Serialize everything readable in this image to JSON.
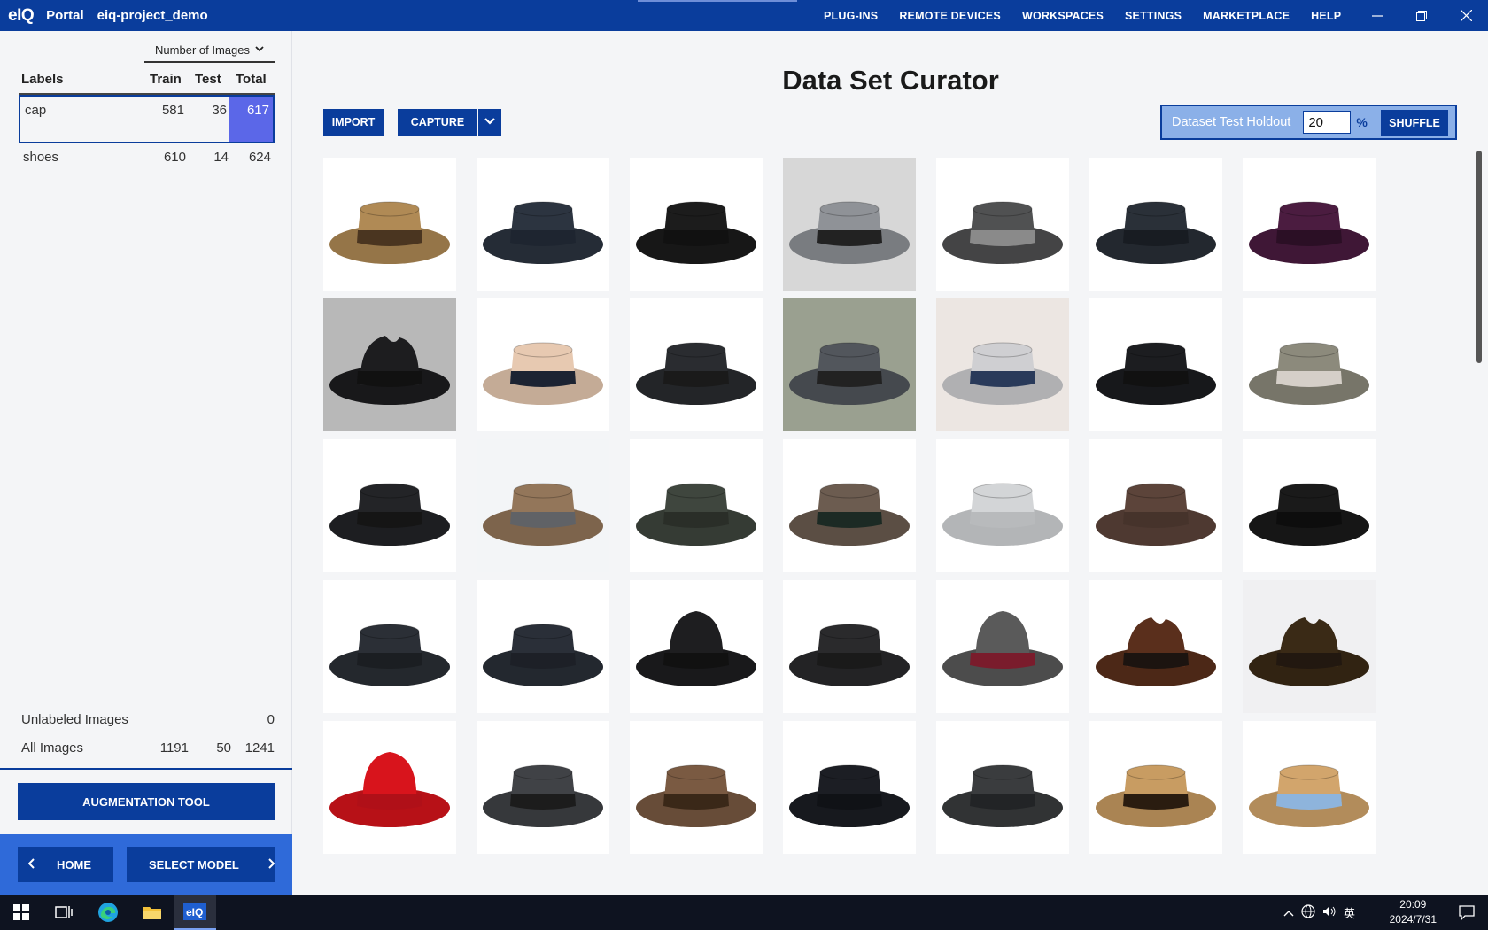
{
  "titlebar": {
    "logo": "eIQ",
    "app_name": "Portal",
    "project": "eiq-project_demo",
    "menu": [
      "PLUG-INS",
      "REMOTE DEVICES",
      "WORKSPACES",
      "SETTINGS",
      "MARKETPLACE",
      "HELP"
    ],
    "window_controls": [
      "minimize-icon",
      "restore-icon",
      "close-icon"
    ]
  },
  "sidebar": {
    "sort_select": "Number of Images",
    "headers": {
      "labels": "Labels",
      "train": "Train",
      "test": "Test",
      "total": "Total"
    },
    "labels": [
      {
        "name": "cap",
        "train": "581",
        "test": "36",
        "total": "617",
        "selected": true
      },
      {
        "name": "shoes",
        "train": "610",
        "test": "14",
        "total": "624",
        "selected": false
      }
    ],
    "unlabeled": {
      "name": "Unlabeled Images",
      "count": "0"
    },
    "all": {
      "name": "All Images",
      "train": "1191",
      "test": "50",
      "total": "1241"
    },
    "augmentation_button": "AUGMENTATION TOOL",
    "home_button": "HOME",
    "select_model_button": "SELECT MODEL"
  },
  "main": {
    "title": "Data Set Curator",
    "import_button": "IMPORT",
    "capture_button": "CAPTURE",
    "holdout": {
      "label": "Dataset Test Holdout",
      "value": "20",
      "unit": "%",
      "shuffle_button": "SHUFFLE"
    },
    "images": [
      {
        "hat": "#b08a55",
        "band": "#4a3520",
        "bg": "#ffffff",
        "style": "pork"
      },
      {
        "hat": "#2c3440",
        "band": "#1e2530",
        "bg": "#ffffff",
        "style": "pork"
      },
      {
        "hat": "#1c1c1c",
        "band": "#111111",
        "bg": "#ffffff",
        "style": "pork"
      },
      {
        "hat": "#8f9297",
        "band": "#222222",
        "bg": "#d7d7d7",
        "style": "pork"
      },
      {
        "hat": "#505152",
        "band": "#8a8a8a",
        "bg": "#ffffff",
        "style": "pork"
      },
      {
        "hat": "#2a3038",
        "band": "#181c22",
        "bg": "#ffffff",
        "style": "pork"
      },
      {
        "hat": "#4b1c40",
        "band": "#2b0f25",
        "bg": "#ffffff",
        "style": "pork"
      },
      {
        "hat": "#1d1d1f",
        "band": "#111111",
        "bg": "#b8b8b8",
        "style": "fedora"
      },
      {
        "hat": "#e7c9b1",
        "band": "#1c2332",
        "bg": "#ffffff",
        "style": "pork"
      },
      {
        "hat": "#2a2c30",
        "band": "#1a1a1a",
        "bg": "#ffffff",
        "style": "pork"
      },
      {
        "hat": "#52565c",
        "band": "#222222",
        "bg": "#9aa090",
        "style": "pork"
      },
      {
        "hat": "#cfcfd2",
        "band": "#293a5a",
        "bg": "#ece6e2",
        "style": "pork"
      },
      {
        "hat": "#1c1d20",
        "band": "#111111",
        "bg": "#ffffff",
        "style": "pork"
      },
      {
        "hat": "#8c8a7c",
        "band": "#d5cfc8",
        "bg": "#ffffff",
        "style": "pork"
      },
      {
        "hat": "#232427",
        "band": "#151515",
        "bg": "#ffffff",
        "style": "pork"
      },
      {
        "hat": "#93765a",
        "band": "#606266",
        "bg": "#f3f5f7",
        "style": "pork"
      },
      {
        "hat": "#3f463e",
        "band": "#2a2e28",
        "bg": "#ffffff",
        "style": "pork"
      },
      {
        "hat": "#6c5c50",
        "band": "#1c2a24",
        "bg": "#ffffff",
        "style": "pork"
      },
      {
        "hat": "#d3d5d7",
        "band": "#b8babc",
        "bg": "#ffffff",
        "style": "pork"
      },
      {
        "hat": "#5c443a",
        "band": "#46332b",
        "bg": "#ffffff",
        "style": "pork"
      },
      {
        "hat": "#1a1a1a",
        "band": "#0d0d0d",
        "bg": "#ffffff",
        "style": "pork"
      },
      {
        "hat": "#2b2f36",
        "band": "#1b1e22",
        "bg": "#ffffff",
        "style": "pork"
      },
      {
        "hat": "#2a2f38",
        "band": "#1d2027",
        "bg": "#ffffff",
        "style": "pork"
      },
      {
        "hat": "#1e1e20",
        "band": "#111111",
        "bg": "#ffffff",
        "style": "tall"
      },
      {
        "hat": "#2a2a2c",
        "band": "#1a1a1a",
        "bg": "#ffffff",
        "style": "pork"
      },
      {
        "hat": "#5a5a5a",
        "band": "#7a1c2c",
        "bg": "#ffffff",
        "style": "tall"
      },
      {
        "hat": "#5a2f1c",
        "band": "#1c1410",
        "bg": "#ffffff",
        "style": "fedora"
      },
      {
        "hat": "#3a2a16",
        "band": "#221810",
        "bg": "#f0f0f2",
        "style": "fedora"
      },
      {
        "hat": "#d8141c",
        "band": "#b01018",
        "bg": "#ffffff",
        "style": "tall"
      },
      {
        "hat": "#404246",
        "band": "#1c1c1c",
        "bg": "#ffffff",
        "style": "pork"
      },
      {
        "hat": "#7a5a42",
        "band": "#3a2818",
        "bg": "#ffffff",
        "style": "pork"
      },
      {
        "hat": "#1c1e24",
        "band": "#101216",
        "bg": "#ffffff",
        "style": "pork"
      },
      {
        "hat": "#3a3c3e",
        "band": "#222426",
        "bg": "#ffffff",
        "style": "pork"
      },
      {
        "hat": "#c89c62",
        "band": "#2a1c10",
        "bg": "#ffffff",
        "style": "pork"
      },
      {
        "hat": "#d2a56c",
        "band": "#8eb4dc",
        "bg": "#ffffff",
        "style": "pork"
      }
    ]
  },
  "taskbar": {
    "ime": "英",
    "time": "20:09",
    "date": "2024/7/31"
  }
}
